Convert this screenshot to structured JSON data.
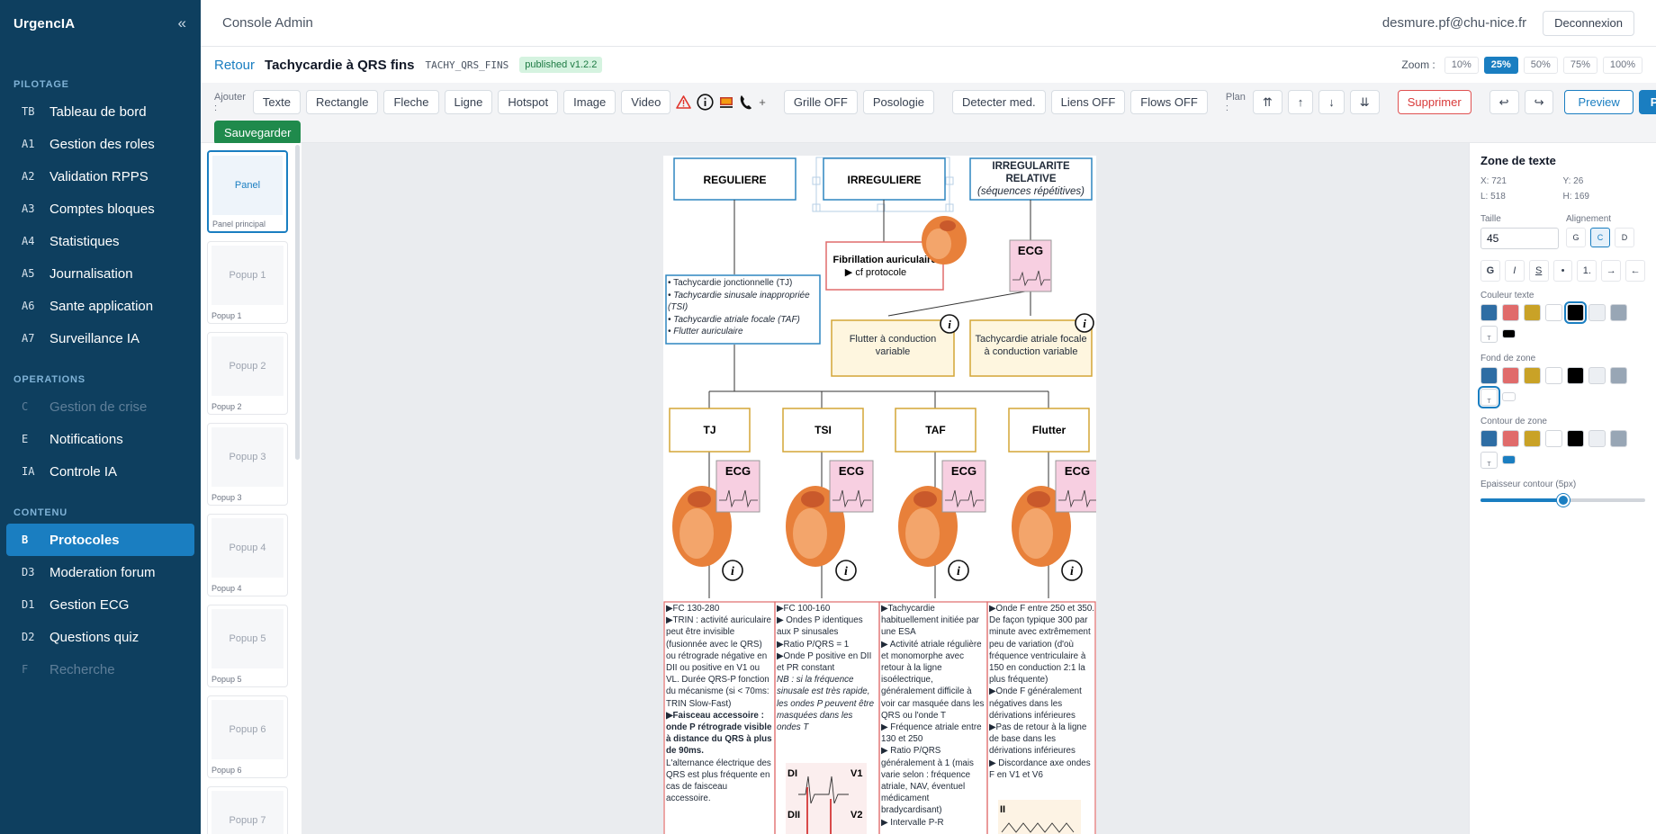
{
  "brand": "UrgencIA",
  "sidebar": {
    "sections": [
      {
        "title": "PILOTAGE",
        "items": [
          {
            "code": "TB",
            "label": "Tableau de bord"
          },
          {
            "code": "A1",
            "label": "Gestion des roles"
          },
          {
            "code": "A2",
            "label": "Validation RPPS"
          },
          {
            "code": "A3",
            "label": "Comptes bloques"
          },
          {
            "code": "A4",
            "label": "Statistiques"
          },
          {
            "code": "A5",
            "label": "Journalisation"
          },
          {
            "code": "A6",
            "label": "Sante application"
          },
          {
            "code": "A7",
            "label": "Surveillance IA"
          }
        ]
      },
      {
        "title": "OPERATIONS",
        "items": [
          {
            "code": "C",
            "label": "Gestion de crise"
          },
          {
            "code": "E",
            "label": "Notifications"
          },
          {
            "code": "IA",
            "label": "Controle IA"
          }
        ]
      },
      {
        "title": "CONTENU",
        "items": [
          {
            "code": "B",
            "label": "Protocoles"
          },
          {
            "code": "D3",
            "label": "Moderation forum"
          },
          {
            "code": "D1",
            "label": "Gestion ECG"
          },
          {
            "code": "D2",
            "label": "Questions quiz"
          },
          {
            "code": "F",
            "label": "Recherche"
          }
        ]
      }
    ]
  },
  "topbar": {
    "title": "Console Admin",
    "email": "desmure.pf@chu-nice.fr",
    "logout": "Deconnexion"
  },
  "protocol": {
    "back": "Retour",
    "title": "Tachycardie à QRS fins",
    "code": "TACHY_QRS_FINS",
    "badge": "published v1.2.2",
    "zoom_label": "Zoom :",
    "zoom": [
      "10%",
      "25%",
      "50%",
      "75%",
      "100%"
    ]
  },
  "toolbar": {
    "add_label": "Ajouter :",
    "add": [
      "Texte",
      "Rectangle",
      "Fleche",
      "Ligne",
      "Hotspot",
      "Image",
      "Video"
    ],
    "plus": "+",
    "toggles": [
      "Grille OFF",
      "Posologie"
    ],
    "tools": [
      "Detecter med.",
      "Liens OFF",
      "Flows OFF"
    ],
    "plan_label": "Plan :",
    "plan": [
      "⇈",
      "↑",
      "↓",
      "⇊"
    ],
    "delete": "Supprimer",
    "undo": "↩",
    "redo": "↪",
    "preview": "Preview",
    "publish": "Publier",
    "save": "Sauvegarder"
  },
  "thumbs": [
    {
      "inner": "Panel",
      "cap": "Panel principal"
    },
    {
      "inner": "Popup 1",
      "cap": "Popup 1"
    },
    {
      "inner": "Popup 2",
      "cap": "Popup 2"
    },
    {
      "inner": "Popup 3",
      "cap": "Popup 3"
    },
    {
      "inner": "Popup 4",
      "cap": "Popup 4"
    },
    {
      "inner": "Popup 5",
      "cap": "Popup 5"
    },
    {
      "inner": "Popup 6",
      "cap": "Popup 6"
    },
    {
      "inner": "Popup 7",
      "cap": ""
    }
  ],
  "props": {
    "title": "Zone de texte",
    "x": "X: 721",
    "y": "Y: 26",
    "l": "L: 518",
    "h": "H: 169",
    "size_label": "Taille",
    "size": "45",
    "align_label": "Alignement",
    "align": [
      "G",
      "C",
      "D"
    ],
    "format": [
      "G",
      "I",
      "S",
      "•",
      "1.",
      "→",
      "←"
    ],
    "text_color_label": "Couleur texte",
    "bg_label": "Fond de zone",
    "border_label": "Contour de zone",
    "border_width_label": "Epaisseur contour (5px)",
    "border_width_level": 0.5,
    "t_mark": "T",
    "palette": [
      "#2e6da4",
      "#e06b6b",
      "#c9a227",
      "#ffffff",
      "#000000",
      "#eceff3",
      "#98a6b5"
    ],
    "text_extra": "#000000",
    "border_extra": "#1a7ec1"
  },
  "diagram": {
    "top": [
      "REGULIERE",
      "IRREGULIERE",
      "IRREGULARITE RELATIVE"
    ],
    "top_sub": "(séquences répétitives)",
    "fa": "Fibrillation auriculaire",
    "fa_sub": "▶ cf protocole",
    "ecg": "ECG",
    "list": [
      "• Tachycardie jonctionnelle (TJ)",
      "• Tachycardie sinusale inappropriée (TSI)",
      "• Tachycardie atriale focale (TAF)",
      "• Flutter auriculaire"
    ],
    "mid": [
      "Flutter à conduction variable",
      "Tachycardie atriale focale à conduction variable"
    ],
    "bottom": [
      "TJ",
      "TSI",
      "TAF",
      "Flutter"
    ],
    "info": "i",
    "col1": [
      "▶FC 130-280",
      "▶TRIN : activité auriculaire peut être invisible (fusionnée avec le QRS) ou rétrograde négative en DII ou positive en V1 ou VL. Durée QRS-P fonction du mécanisme (si < 70ms: TRIN Slow-Fast)",
      "▶Faisceau accessoire : onde P rétrograde visible à distance du QRS à plus de 90ms.",
      "L'alternance électrique des QRS est plus fréquente en cas de faisceau accessoire."
    ],
    "col2": [
      "▶FC 100-160",
      "▶ Ondes P identiques aux P sinusales",
      "▶Ratio P/QRS = 1",
      "▶Onde P positive en DII et PR constant",
      "NB : si la fréquence sinusale est très rapide, les ondes P peuvent être masquées dans les ondes T"
    ],
    "col3": [
      "▶Tachycardie habituellement initiée par une ESA",
      "▶ Activité atriale régulière et monomorphe avec retour à la ligne isoélectrique, généralement difficile à voir car masquée dans les QRS ou l'onde T",
      "▶ Fréquence atriale entre 130 et 250",
      "▶ Ratio P/QRS généralement à 1 (mais varie selon : fréquence atriale, NAV, éventuel médicament bradycardisant)",
      "▶ Intervalle P-R"
    ],
    "col4": [
      "▶Onde F entre 250 et 350. De façon typique 300 par minute avec extrêmement peu de variation (d'où fréquence ventriculaire à 150 en conduction 2:1 la plus fréquente)",
      "▶Onde F généralement négatives dans les dérivations inférieures",
      "▶Pas de retour à la ligne de base dans les dérivations inférieures",
      "▶ Discordance axe ondes F en V1 et V6"
    ],
    "leads": [
      "DI",
      "V1",
      "DII",
      "V2",
      "II"
    ]
  }
}
